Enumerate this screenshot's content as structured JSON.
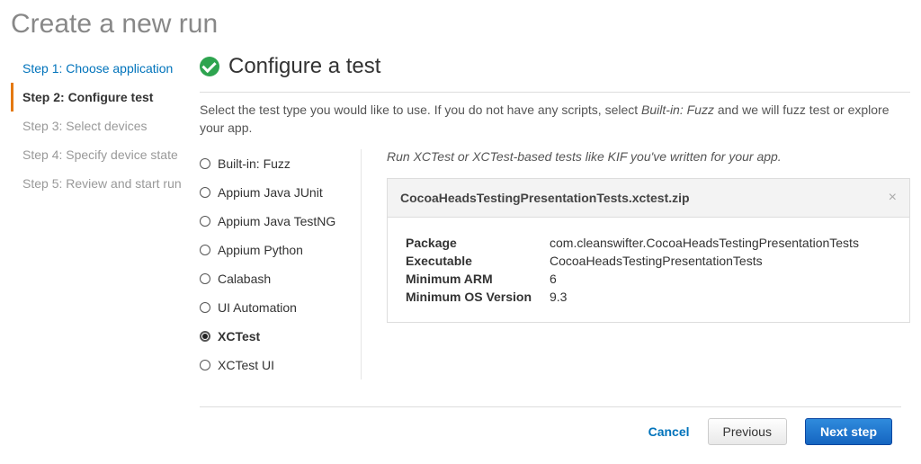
{
  "page_title": "Create a new run",
  "steps": [
    {
      "label": "Step 1: Choose application",
      "state": "link"
    },
    {
      "label": "Step 2: Configure test",
      "state": "active"
    },
    {
      "label": "Step 3: Select devices",
      "state": "disabled"
    },
    {
      "label": "Step 4: Specify device state",
      "state": "disabled"
    },
    {
      "label": "Step 5: Review and start run",
      "state": "disabled"
    }
  ],
  "section": {
    "title": "Configure a test",
    "description_pre": "Select the test type you would like to use. If you do not have any scripts, select ",
    "description_em": "Built-in: Fuzz",
    "description_post": " and we will fuzz test or explore your app."
  },
  "tests": [
    {
      "label": "Built-in: Fuzz",
      "selected": false
    },
    {
      "label": "Appium Java JUnit",
      "selected": false
    },
    {
      "label": "Appium Java TestNG",
      "selected": false
    },
    {
      "label": "Appium Python",
      "selected": false
    },
    {
      "label": "Calabash",
      "selected": false
    },
    {
      "label": "UI Automation",
      "selected": false
    },
    {
      "label": "XCTest",
      "selected": true
    },
    {
      "label": "XCTest UI",
      "selected": false
    }
  ],
  "detail": {
    "headline": "Run XCTest or XCTest-based tests like KIF you've written for your app.",
    "filename": "CocoaHeadsTestingPresentationTests.xctest.zip",
    "rows": {
      "package_k": "Package",
      "package_v": "com.cleanswifter.CocoaHeadsTestingPresentationTests",
      "executable_k": "Executable",
      "executable_v": "CocoaHeadsTestingPresentationTests",
      "min_arm_k": "Minimum ARM",
      "min_arm_v": "6",
      "min_os_k": "Minimum OS Version",
      "min_os_v": "9.3"
    }
  },
  "footer": {
    "cancel": "Cancel",
    "previous": "Previous",
    "next": "Next step"
  }
}
